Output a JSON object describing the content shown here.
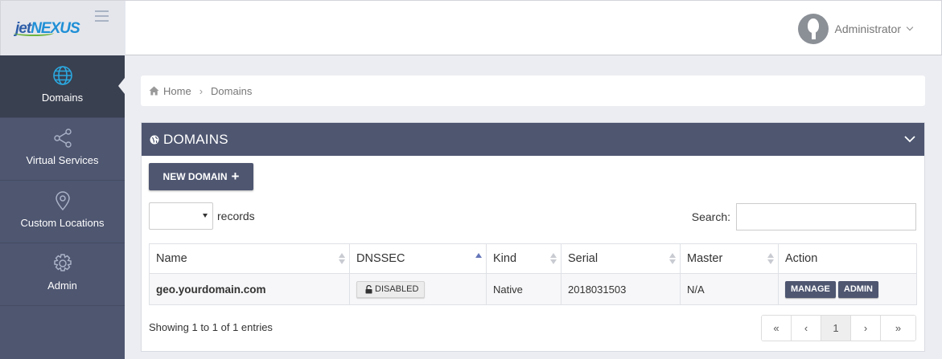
{
  "app": {
    "logo_prefix": "jet",
    "logo_suffix": "NEXUS",
    "user_name": "Administrator"
  },
  "sidebar": {
    "items": [
      {
        "label": "Domains",
        "icon": "globe-icon",
        "active": true
      },
      {
        "label": "Virtual Services",
        "icon": "share-icon",
        "active": false
      },
      {
        "label": "Custom Locations",
        "icon": "map-pin-icon",
        "active": false
      },
      {
        "label": "Admin",
        "icon": "gear-icon",
        "active": false
      }
    ]
  },
  "breadcrumb": {
    "home": "Home",
    "current": "Domains"
  },
  "panel": {
    "title": "DOMAINS",
    "new_button": "NEW DOMAIN",
    "length_label": "records",
    "length_value": "",
    "search_label": "Search:",
    "search_value": ""
  },
  "table": {
    "columns": [
      "Name",
      "DNSSEC",
      "Kind",
      "Serial",
      "Master",
      "Action"
    ],
    "rows": [
      {
        "name": "geo.yourdomain.com",
        "dnssec": "DISABLED",
        "kind": "Native",
        "serial": "2018031503",
        "master": "N/A",
        "actions": [
          "MANAGE",
          "ADMIN"
        ]
      }
    ]
  },
  "footer": {
    "info": "Showing 1 to 1 of 1 entries",
    "pager": [
      "«",
      "‹",
      "1",
      "›",
      "»"
    ]
  },
  "colors": {
    "sidebar": "#4e5670",
    "sidebar_active": "#394050",
    "accent": "#4e5670",
    "background": "#ecedf2"
  }
}
